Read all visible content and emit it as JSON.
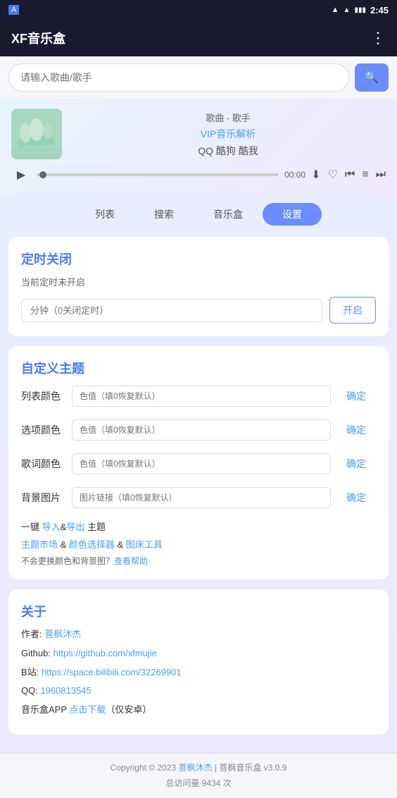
{
  "statusBar": {
    "appIcon": "A",
    "time": "2:45",
    "icons": [
      "wifi",
      "signal",
      "battery"
    ]
  },
  "topBar": {
    "title": "XF音乐盒",
    "moreIcon": "⋮"
  },
  "search": {
    "placeholder": "请输入歌曲/歌手",
    "searchIconUnicode": "🔍"
  },
  "player": {
    "songInfo": "歌曲 - 歌手",
    "vipText": "VIP音乐解析",
    "platforms": "QQ 酷狗 酷我",
    "time": "00:00",
    "playIcon": "▶",
    "downloadIcon": "⬇",
    "favoriteIcon": "♡",
    "prevIcon": "⏮",
    "listIcon": "≡",
    "nextIcon": "⏭"
  },
  "tabs": [
    {
      "label": "列表",
      "active": false
    },
    {
      "label": "搜索",
      "active": false
    },
    {
      "label": "音乐盒",
      "active": false
    },
    {
      "label": "设置",
      "active": true
    }
  ],
  "timerSection": {
    "title": "定时关闭",
    "subtitle": "当前定时未开启",
    "inputPlaceholder": "分钟（0关闭定时）",
    "openBtn": "开启"
  },
  "themeSection": {
    "title": "自定义主题",
    "rows": [
      {
        "label": "列表颜色",
        "placeholder": "色值（填0恢复默认）",
        "confirm": "确定"
      },
      {
        "label": "选项颜色",
        "placeholder": "色值（填0恢复默认）",
        "confirm": "确定"
      },
      {
        "label": "歌词颜色",
        "placeholder": "色值（填0恢复默认）",
        "confirm": "确定"
      },
      {
        "label": "背景图片",
        "placeholder": "图片链接（填0恢复默认）",
        "confirm": "确定"
      }
    ],
    "importExportText": "一键 导入&导出 主题",
    "importLink": "导入",
    "exportLink": "导出",
    "toolsLine1": "主题市场 & 颜色选择器 & 图床工具",
    "toolsLink1": "主题市场",
    "toolsLink2": "颜色选择器",
    "toolsLink3": "图床工具",
    "colorNote": "不会更换颜色和背景图？",
    "helpLink": "查看帮助"
  },
  "aboutSection": {
    "title": "关于",
    "author": "菩枫沐杰",
    "authorLink": "菩枫沐杰",
    "githubLabel": "Github: ",
    "githubUrl": "https://github.com/xfmujie",
    "githubText": "https://github.com/xfmujie",
    "bStationLabel": "B站: ",
    "bStationUrl": "https://space.bilibili.com/32269901",
    "bStationText": "https://space.bilibili.com/32269901",
    "qqLabel": "QQ: ",
    "qqNumber": "1960813545",
    "appDownloadLabel": "音乐盒APP ",
    "downloadLink": "点击下载",
    "downloadNote": "（仅安卓）"
  },
  "footer": {
    "copyright": "Copyright © 2023 菩枫沐杰 | 菩枫音乐盒 v3.0.9",
    "visits": "总访问量 9434 次",
    "authorLink": "菩枫沐杰"
  }
}
